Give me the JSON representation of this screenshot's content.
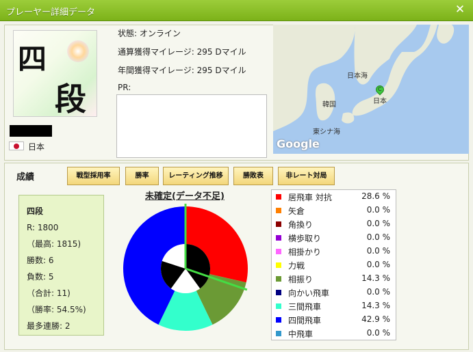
{
  "window": {
    "title": "プレーヤー詳細データ",
    "close_icon": "close-icon"
  },
  "profile": {
    "rank_char_1": "四",
    "rank_char_2": "段",
    "country": "日本",
    "flag_icon": "japan-flag-icon",
    "status": "状態: オンライン",
    "total_mileage": "通算獲得マイレージ: 295 Dマイル",
    "annual_mileage": "年間獲得マイレージ: 295 Dマイル",
    "pr_label": "PR:",
    "pr_text": ""
  },
  "map": {
    "labels": {
      "sea_of_japan": "日本海",
      "korea": "韓国",
      "japan": "日本",
      "east_china_sea": "東シナ海"
    },
    "pin_label": "C",
    "logo": "Google"
  },
  "record": {
    "title": "成績",
    "buttons": [
      "戦型採用率",
      "勝率",
      "レーティング推移",
      "勝敗表",
      "非レート対局"
    ]
  },
  "stats": {
    "rank": "四段",
    "rating": "R: 1800",
    "max_rating": "（最高: 1815)",
    "wins": "勝数: 6",
    "losses": "負数: 5",
    "total": "（合計: 11)",
    "win_rate": "（勝率: 54.5%)",
    "streak": "最多連勝: 2"
  },
  "chart_data": {
    "type": "pie",
    "title": "未確定(データ不足)",
    "slices": [
      {
        "name": "居飛車 対抗",
        "value": 28.6,
        "color": "#ff0000"
      },
      {
        "name": "矢倉",
        "value": 0.0,
        "color": "#ff7f00"
      },
      {
        "name": "角換り",
        "value": 0.0,
        "color": "#8b0000"
      },
      {
        "name": "横歩取り",
        "value": 0.0,
        "color": "#9400d3"
      },
      {
        "name": "相掛かり",
        "value": 0.0,
        "color": "#ff66ff"
      },
      {
        "name": "力戦",
        "value": 0.0,
        "color": "#ffff00"
      },
      {
        "name": "相振り",
        "value": 14.3,
        "color": "#6b9a35"
      },
      {
        "name": "向かい飛車",
        "value": 0.0,
        "color": "#000080"
      },
      {
        "name": "三間飛車",
        "value": 14.3,
        "color": "#33ffcc"
      },
      {
        "name": "四間飛車",
        "value": 42.9,
        "color": "#0000ff"
      },
      {
        "name": "中飛車",
        "value": 0.0,
        "color": "#3399cc"
      }
    ],
    "pct_texts": [
      "28.6 %",
      "0.0 %",
      "0.0 %",
      "0.0 %",
      "0.0 %",
      "0.0 %",
      "14.3 %",
      "0.0 %",
      "14.3 %",
      "42.9 %",
      "0.0 %"
    ],
    "inner_ring": [
      {
        "value": 40,
        "color": "#000000"
      },
      {
        "value": 20,
        "color": "#ffffff"
      },
      {
        "value": 20,
        "color": "#000000"
      },
      {
        "value": 20,
        "color": "#ffffff"
      }
    ],
    "markers": [
      {
        "angle_deg": 0,
        "color": "#44dd44"
      },
      {
        "angle_deg": 109,
        "color": "#44dd44"
      }
    ]
  }
}
